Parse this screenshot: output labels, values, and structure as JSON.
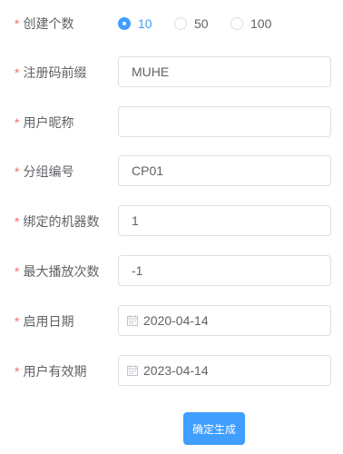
{
  "form": {
    "count": {
      "label": "创建个数",
      "options": [
        {
          "label": "10",
          "selected": true
        },
        {
          "label": "50",
          "selected": false
        },
        {
          "label": "100",
          "selected": false
        }
      ]
    },
    "prefix": {
      "label": "注册码前缀",
      "value": "MUHE"
    },
    "nickname": {
      "label": "用户昵称",
      "value": ""
    },
    "group": {
      "label": "分组编号",
      "value": "CP01"
    },
    "machines": {
      "label": "绑定的机器数",
      "value": "1"
    },
    "max_plays": {
      "label": "最大播放次数",
      "value": "-1"
    },
    "start_date": {
      "label": "启用日期",
      "value": "2020-04-14"
    },
    "expiry_date": {
      "label": "用户有效期",
      "value": "2023-04-14"
    },
    "submit_label": "确定生成"
  },
  "colors": {
    "primary": "#409eff",
    "required": "#f56c6c",
    "text": "#606266",
    "border": "#dcdfe6"
  },
  "icons": {
    "radio_selected": "radio-checked-icon",
    "date": "calendar-icon"
  }
}
